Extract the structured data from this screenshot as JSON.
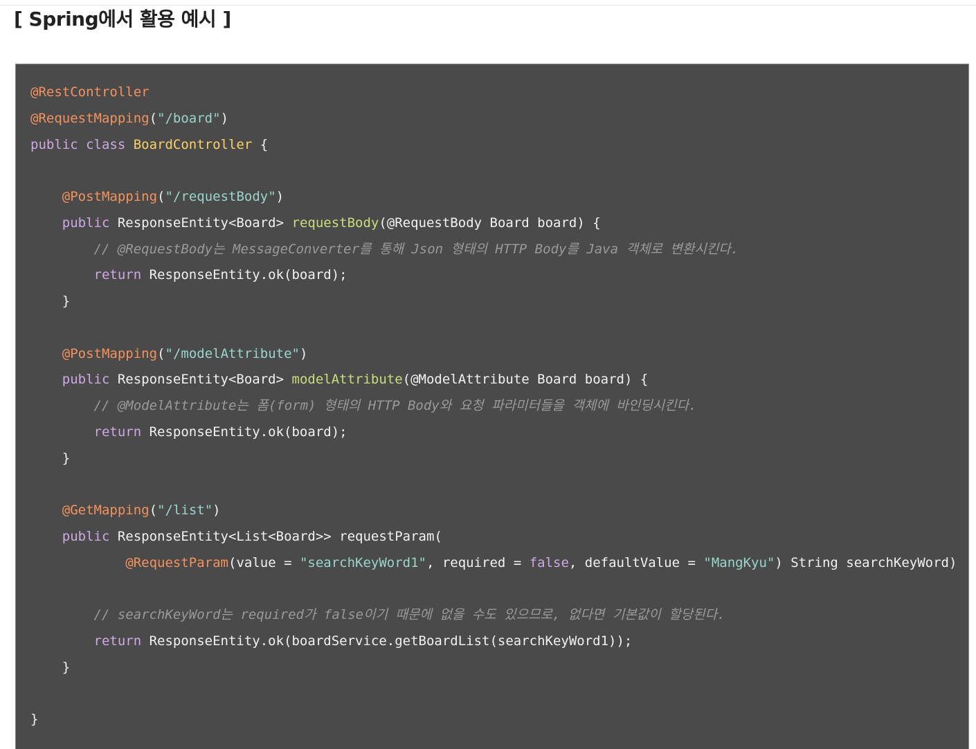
{
  "heading": "[ Spring에서 활용 예시 ]",
  "colors": {
    "page_background": "#ffffff",
    "code_background": "#494a49",
    "annotation": "#f5925e",
    "string": "#99d6cc",
    "keyword": "#cfa8e6",
    "class_name": "#fbd16a",
    "method_name": "#c8de7c",
    "plain": "#f2f2f2",
    "comment": "#9a9a9a"
  },
  "code": {
    "language": "java",
    "lines": [
      [
        {
          "t": "@RestController",
          "k": "annotation"
        }
      ],
      [
        {
          "t": "@RequestMapping",
          "k": "annotation"
        },
        {
          "t": "(",
          "k": "plain"
        },
        {
          "t": "\"/board\"",
          "k": "string"
        },
        {
          "t": ")",
          "k": "plain"
        }
      ],
      [
        {
          "t": "public class ",
          "k": "keyword"
        },
        {
          "t": "BoardController",
          "k": "class"
        },
        {
          "t": " {",
          "k": "plain"
        }
      ],
      [],
      [
        {
          "t": "    ",
          "k": "plain"
        },
        {
          "t": "@PostMapping",
          "k": "annotation"
        },
        {
          "t": "(",
          "k": "plain"
        },
        {
          "t": "\"/requestBody\"",
          "k": "string"
        },
        {
          "t": ")",
          "k": "plain"
        }
      ],
      [
        {
          "t": "    ",
          "k": "plain"
        },
        {
          "t": "public",
          "k": "keyword"
        },
        {
          "t": " ResponseEntity<Board> ",
          "k": "plain"
        },
        {
          "t": "requestBody",
          "k": "method"
        },
        {
          "t": "(@RequestBody Board board) {",
          "k": "plain"
        }
      ],
      [
        {
          "t": "        ",
          "k": "plain"
        },
        {
          "t": "// @RequestBody는 MessageConverter를 통해 Json 형태의 HTTP Body를 Java 객체로 변환시킨다.",
          "k": "comment"
        }
      ],
      [
        {
          "t": "        ",
          "k": "plain"
        },
        {
          "t": "return",
          "k": "keyword"
        },
        {
          "t": " ResponseEntity.ok(board);",
          "k": "plain"
        }
      ],
      [
        {
          "t": "    }",
          "k": "plain"
        }
      ],
      [],
      [
        {
          "t": "    ",
          "k": "plain"
        },
        {
          "t": "@PostMapping",
          "k": "annotation"
        },
        {
          "t": "(",
          "k": "plain"
        },
        {
          "t": "\"/modelAttribute\"",
          "k": "string"
        },
        {
          "t": ")",
          "k": "plain"
        }
      ],
      [
        {
          "t": "    ",
          "k": "plain"
        },
        {
          "t": "public",
          "k": "keyword"
        },
        {
          "t": " ResponseEntity<Board> ",
          "k": "plain"
        },
        {
          "t": "modelAttribute",
          "k": "method"
        },
        {
          "t": "(@ModelAttribute Board board) {",
          "k": "plain"
        }
      ],
      [
        {
          "t": "        ",
          "k": "plain"
        },
        {
          "t": "// @ModelAttribute는 폼(form) 형태의 HTTP Body와 요청 파라미터들을 객체에 바인딩시킨다.",
          "k": "comment"
        }
      ],
      [
        {
          "t": "        ",
          "k": "plain"
        },
        {
          "t": "return",
          "k": "keyword"
        },
        {
          "t": " ResponseEntity.ok(board);",
          "k": "plain"
        }
      ],
      [
        {
          "t": "    }",
          "k": "plain"
        }
      ],
      [],
      [
        {
          "t": "    ",
          "k": "plain"
        },
        {
          "t": "@GetMapping",
          "k": "annotation"
        },
        {
          "t": "(",
          "k": "plain"
        },
        {
          "t": "\"/list\"",
          "k": "string"
        },
        {
          "t": ")",
          "k": "plain"
        }
      ],
      [
        {
          "t": "    ",
          "k": "plain"
        },
        {
          "t": "public",
          "k": "keyword"
        },
        {
          "t": " ResponseEntity<List<Board>> requestParam(",
          "k": "plain"
        }
      ],
      [
        {
          "t": "            ",
          "k": "plain"
        },
        {
          "t": "@RequestParam",
          "k": "annotation"
        },
        {
          "t": "(value = ",
          "k": "plain"
        },
        {
          "t": "\"searchKeyWord1\"",
          "k": "string"
        },
        {
          "t": ", required = ",
          "k": "plain"
        },
        {
          "t": "false",
          "k": "keyword"
        },
        {
          "t": ", defaultValue = ",
          "k": "plain"
        },
        {
          "t": "\"MangKyu\"",
          "k": "string"
        },
        {
          "t": ") String searchKeyWord)",
          "k": "plain"
        }
      ],
      [],
      [
        {
          "t": "        ",
          "k": "plain"
        },
        {
          "t": "// searchKeyWord는 required가 false이기 때문에 없을 수도 있으므로, 없다면 기본값이 할당된다.",
          "k": "comment"
        }
      ],
      [
        {
          "t": "        ",
          "k": "plain"
        },
        {
          "t": "return",
          "k": "keyword"
        },
        {
          "t": " ResponseEntity.ok(boardService.getBoardList(searchKeyWord1));",
          "k": "plain"
        }
      ],
      [
        {
          "t": "    }",
          "k": "plain"
        }
      ],
      [],
      [
        {
          "t": "}",
          "k": "plain"
        }
      ]
    ]
  }
}
